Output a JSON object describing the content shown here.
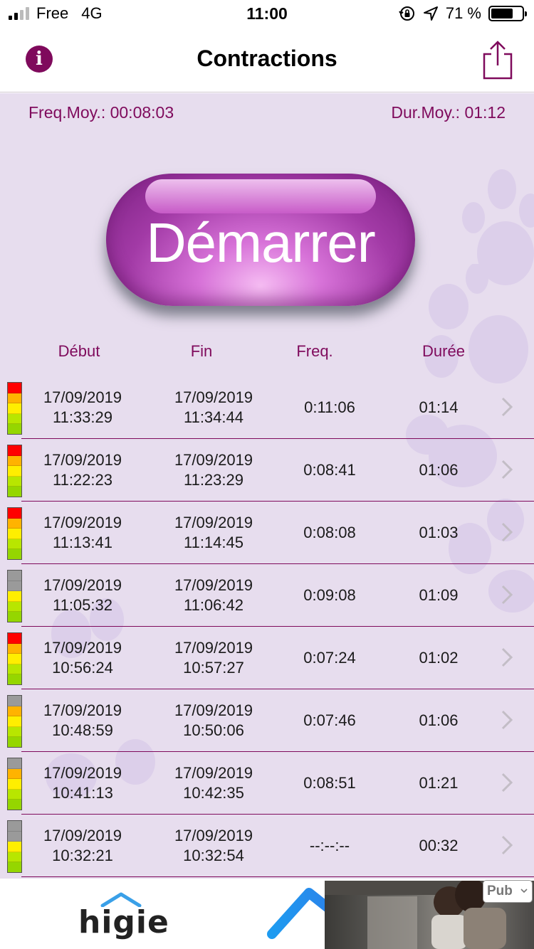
{
  "status_bar": {
    "carrier": "Free",
    "network": "4G",
    "time": "11:00",
    "battery_text": "71 %",
    "battery_level": 0.71
  },
  "nav": {
    "title": "Contractions",
    "info_icon": "info-icon",
    "share_icon": "share-icon"
  },
  "summary": {
    "freq_avg": "Freq.Moy.: 00:08:03",
    "dur_avg": "Dur.Moy.: 01:12"
  },
  "start_button": {
    "label": "Démarrer"
  },
  "table": {
    "headers": {
      "debut": "Début",
      "fin": "Fin",
      "freq": "Freq.",
      "duree": "Durée"
    },
    "rows": [
      {
        "debut_date": "17/09/2019",
        "debut_time": "11:33:29",
        "fin_date": "17/09/2019",
        "fin_time": "11:34:44",
        "freq": "0:11:06",
        "duree": "01:14",
        "top_level": "red"
      },
      {
        "debut_date": "17/09/2019",
        "debut_time": "11:22:23",
        "fin_date": "17/09/2019",
        "fin_time": "11:23:29",
        "freq": "0:08:41",
        "duree": "01:06",
        "top_level": "red"
      },
      {
        "debut_date": "17/09/2019",
        "debut_time": "11:13:41",
        "fin_date": "17/09/2019",
        "fin_time": "11:14:45",
        "freq": "0:08:08",
        "duree": "01:03",
        "top_level": "red"
      },
      {
        "debut_date": "17/09/2019",
        "debut_time": "11:05:32",
        "fin_date": "17/09/2019",
        "fin_time": "11:06:42",
        "freq": "0:09:08",
        "duree": "01:09",
        "top_level": "gray2"
      },
      {
        "debut_date": "17/09/2019",
        "debut_time": "10:56:24",
        "fin_date": "17/09/2019",
        "fin_time": "10:57:27",
        "freq": "0:07:24",
        "duree": "01:02",
        "top_level": "red"
      },
      {
        "debut_date": "17/09/2019",
        "debut_time": "10:48:59",
        "fin_date": "17/09/2019",
        "fin_time": "10:50:06",
        "freq": "0:07:46",
        "duree": "01:06",
        "top_level": "gray1"
      },
      {
        "debut_date": "17/09/2019",
        "debut_time": "10:41:13",
        "fin_date": "17/09/2019",
        "fin_time": "10:42:35",
        "freq": "0:08:51",
        "duree": "01:21",
        "top_level": "gray1"
      },
      {
        "debut_date": "17/09/2019",
        "debut_time": "10:32:21",
        "fin_date": "17/09/2019",
        "fin_time": "10:32:54",
        "freq": "--:--:--",
        "duree": "00:32",
        "top_level": "gray2"
      }
    ]
  },
  "ad": {
    "brand": "higie",
    "tag": "Pub"
  },
  "colors": {
    "accent": "#7f0a5c",
    "background": "#e7ddee",
    "level_red": "#ff0000",
    "level_orange": "#ffb300",
    "level_yellow": "#ffee00",
    "level_lime": "#b8e600",
    "level_green": "#95d600",
    "level_gray": "#9a9a9a"
  }
}
